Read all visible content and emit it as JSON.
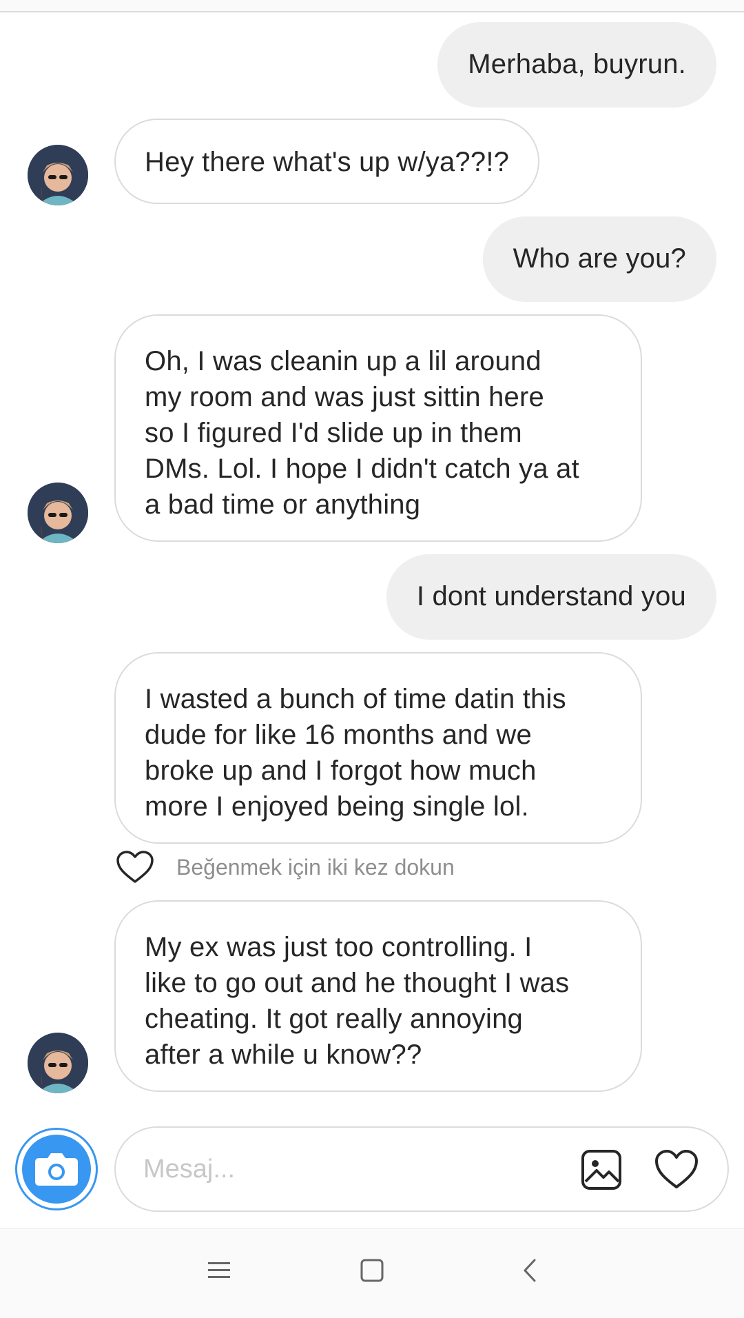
{
  "conversation": {
    "messages": [
      {
        "from": "me",
        "text": "Merhaba, buyrun."
      },
      {
        "from": "them",
        "text": "Hey there what's up w/ya??!?"
      },
      {
        "from": "me",
        "text": "Who are you?"
      },
      {
        "from": "them",
        "lines": [
          "Oh, I was cleanin up a lil around",
          "my room and was just sittin here",
          "so I figured I'd slide up in them",
          "DMs. Lol. I hope I didn't catch ya at",
          "a bad time or anything"
        ]
      },
      {
        "from": "me",
        "text": "I dont understand you"
      },
      {
        "from": "them",
        "lines": [
          "I wasted a bunch of time datin this",
          "dude for like 16 months and we",
          "broke up and I forgot how much",
          "more I enjoyed being single lol."
        ]
      },
      {
        "from": "them",
        "lines": [
          "My ex was just too controlling. I",
          "like to go out and he thought I was",
          "cheating. It got really annoying",
          "after a while u know??"
        ]
      }
    ],
    "like_hint": "Beğenmek için iki kez dokun"
  },
  "composer": {
    "placeholder": "Mesaj...",
    "camera_icon": "camera-icon",
    "gallery_icon": "image-icon",
    "like_icon": "heart-icon"
  },
  "system_nav": {
    "menu_icon": "menu-icon",
    "home_icon": "square-icon",
    "back_icon": "back-chevron-icon"
  },
  "colors": {
    "outgoing_bubble": "#efefef",
    "incoming_border": "#dbdbdb",
    "accent": "#3897f0",
    "hint_text": "#8e8e8e"
  }
}
